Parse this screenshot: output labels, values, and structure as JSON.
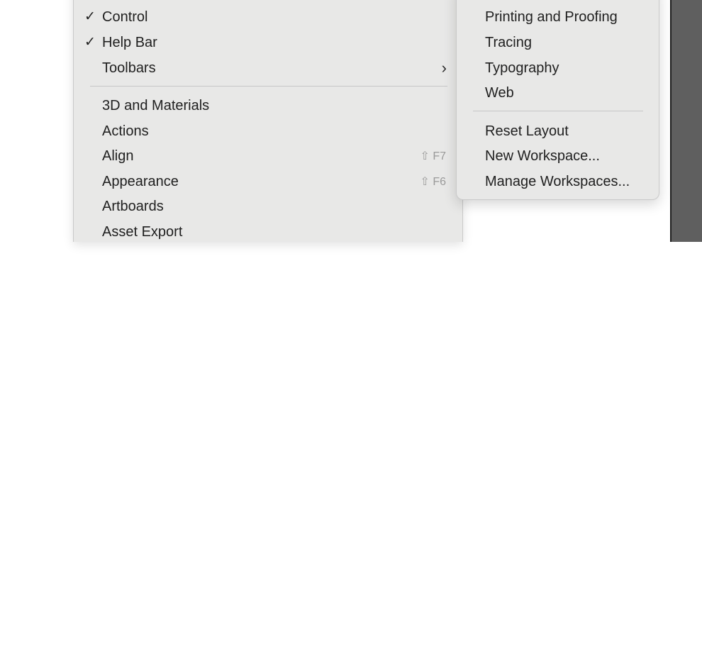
{
  "window_menu": {
    "items": [
      {
        "label": "Control",
        "checked": true,
        "check_glyph": "✓"
      },
      {
        "label": "Help Bar",
        "checked": true,
        "check_glyph": "✓"
      },
      {
        "label": "Toolbars",
        "submenu_glyph": "›"
      },
      {
        "label": "3D and Materials"
      },
      {
        "label": "Actions"
      },
      {
        "label": "Align",
        "shortcut": "⇧ F7"
      },
      {
        "label": "Appearance",
        "shortcut": "⇧ F6"
      },
      {
        "label": "Artboards"
      },
      {
        "label": "Asset Export"
      }
    ]
  },
  "workspace_submenu": {
    "workspaces": [
      {
        "label": "Printing and Proofing"
      },
      {
        "label": "Tracing"
      },
      {
        "label": "Typography"
      },
      {
        "label": "Web"
      }
    ],
    "actions": [
      {
        "label": "Reset Layout"
      },
      {
        "label": "New Workspace..."
      },
      {
        "label": "Manage Workspaces..."
      }
    ]
  },
  "colors": {
    "menu_background": "#e8e8e7",
    "separator": "#c6c6c6",
    "side_panel": "#5f5f5f",
    "shortcut_text": "#9a9a9a"
  }
}
